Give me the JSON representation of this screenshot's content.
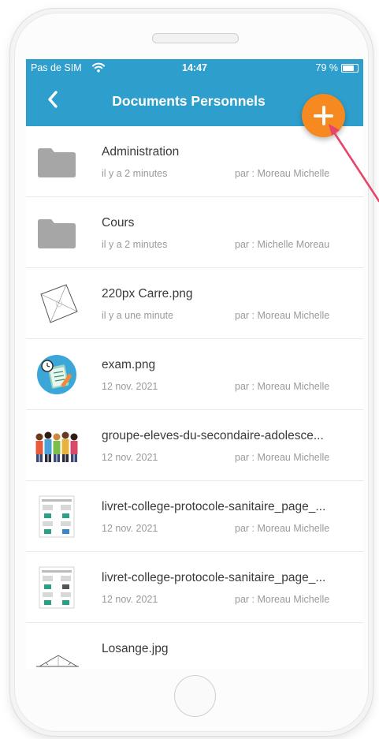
{
  "status": {
    "carrier": "Pas de SIM",
    "time": "14:47",
    "battery": "79 %",
    "battery_level": 0.79
  },
  "navbar": {
    "title": "Documents Personnels"
  },
  "files": [
    {
      "name": "Administration",
      "date": "il y a 2 minutes",
      "owner": "par : Moreau Michelle",
      "icon": "folder-icon"
    },
    {
      "name": "Cours",
      "date": "il y a 2 minutes",
      "owner": "par : Michelle Moreau",
      "icon": "folder-icon"
    },
    {
      "name": "220px Carre.png",
      "date": "il y a une minute",
      "owner": "par : Moreau Michelle",
      "icon": "square-geometry-thumbnail"
    },
    {
      "name": "exam.png",
      "date": "12 nov. 2021",
      "owner": "par : Moreau Michelle",
      "icon": "exam-thumbnail"
    },
    {
      "name": "groupe-eleves-du-secondaire-adolesce...",
      "date": "12 nov. 2021",
      "owner": "par : Moreau Michelle",
      "icon": "students-group-thumbnail"
    },
    {
      "name": "livret-college-protocole-sanitaire_page_...",
      "date": "12 nov. 2021",
      "owner": "par : Moreau Michelle",
      "icon": "document-page-thumbnail"
    },
    {
      "name": "livret-college-protocole-sanitaire_page_...",
      "date": "12 nov. 2021",
      "owner": "par : Moreau Michelle",
      "icon": "document-page-thumbnail"
    },
    {
      "name": "Losange.jpg",
      "date": "",
      "owner": "",
      "icon": "rhombus-geometry-thumbnail"
    }
  ],
  "colors": {
    "header": "#2e9fcc",
    "accent": "#f6891f",
    "annotation_arrow": "#e8456a"
  }
}
